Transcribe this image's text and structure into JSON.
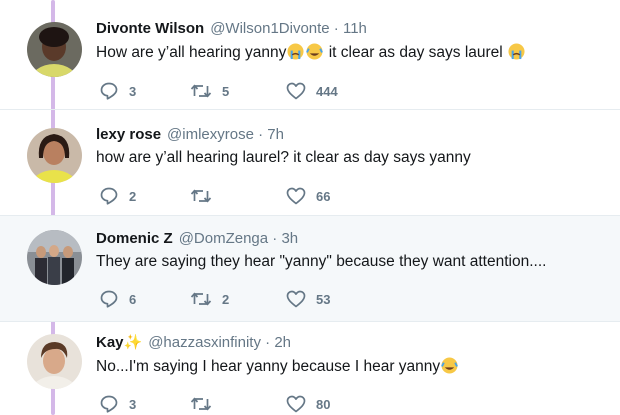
{
  "tweets": [
    {
      "name": "Divonte Wilson",
      "handle": "@Wilson1Divonte",
      "time": " · 11h",
      "text_parts": [
        "How are y’all hearing yanny",
        " it clear as day says laurel "
      ],
      "replies": "3",
      "retweets": "5",
      "likes": "444",
      "avatar_icon": "profile-photo"
    },
    {
      "name": "lexy rose",
      "handle": "@imlexyrose",
      "time": " · 7h",
      "text": "how are y’all hearing laurel? it clear as day says yanny",
      "replies": "2",
      "retweets": "",
      "likes": "66",
      "avatar_icon": "profile-photo"
    },
    {
      "name": "Domenic Z",
      "handle": "@DomZenga",
      "time": " · 3h",
      "text": "They are saying they hear \"yanny\" because they want attention....",
      "replies": "6",
      "retweets": "2",
      "likes": "53",
      "avatar_icon": "group-photo"
    },
    {
      "name": "Kay✨",
      "handle": "@hazzasxinfinity",
      "time": " · 2h",
      "text": "No...I'm saying I hear yanny because I hear yanny",
      "replies": "3",
      "retweets": "",
      "likes": "80",
      "avatar_icon": "profile-photo"
    }
  ],
  "icons": {
    "reply": "reply-icon",
    "retweet": "retweet-icon",
    "like": "heart-icon",
    "emoji": "crying-emoji-icon"
  },
  "colors": {
    "thread_line": "#d4b8e8",
    "shaded_bg": "#f5f8fa",
    "muted": "#657786"
  }
}
